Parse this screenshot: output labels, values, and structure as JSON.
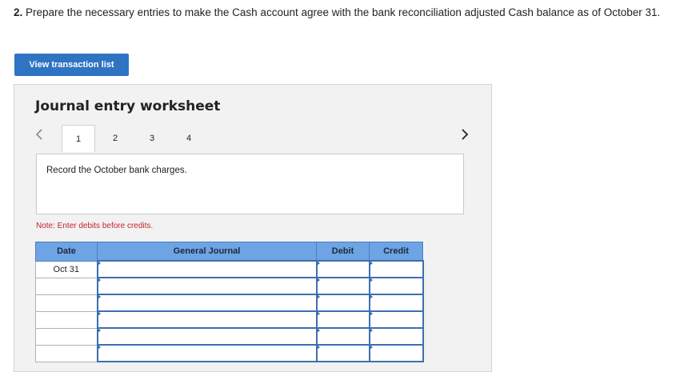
{
  "question": {
    "number": "2.",
    "text": "Prepare the necessary entries to make the Cash account agree with the bank reconciliation adjusted Cash balance as of October 31."
  },
  "view_button": {
    "label": "View transaction list"
  },
  "worksheet": {
    "title": "Journal entry worksheet",
    "tabs": [
      "1",
      "2",
      "3",
      "4"
    ],
    "active_tab": "1",
    "prev_icon": "chevron-left-icon",
    "next_icon": "chevron-right-icon",
    "description": "Record the October bank charges.",
    "note": "Note: Enter debits before credits."
  },
  "journal_table": {
    "headers": {
      "date": "Date",
      "general_journal": "General Journal",
      "debit": "Debit",
      "credit": "Credit"
    },
    "rows": [
      {
        "date": "Oct 31",
        "account": "",
        "debit": "",
        "credit": ""
      },
      {
        "date": "",
        "account": "",
        "debit": "",
        "credit": ""
      },
      {
        "date": "",
        "account": "",
        "debit": "",
        "credit": ""
      },
      {
        "date": "",
        "account": "",
        "debit": "",
        "credit": ""
      },
      {
        "date": "",
        "account": "",
        "debit": "",
        "credit": ""
      },
      {
        "date": "",
        "account": "",
        "debit": "",
        "credit": ""
      }
    ]
  },
  "colors": {
    "primary_button": "#2f73c3",
    "table_header": "#6ea4e4",
    "note_red": "#c0262d",
    "panel_bg": "#f2f2f2"
  }
}
